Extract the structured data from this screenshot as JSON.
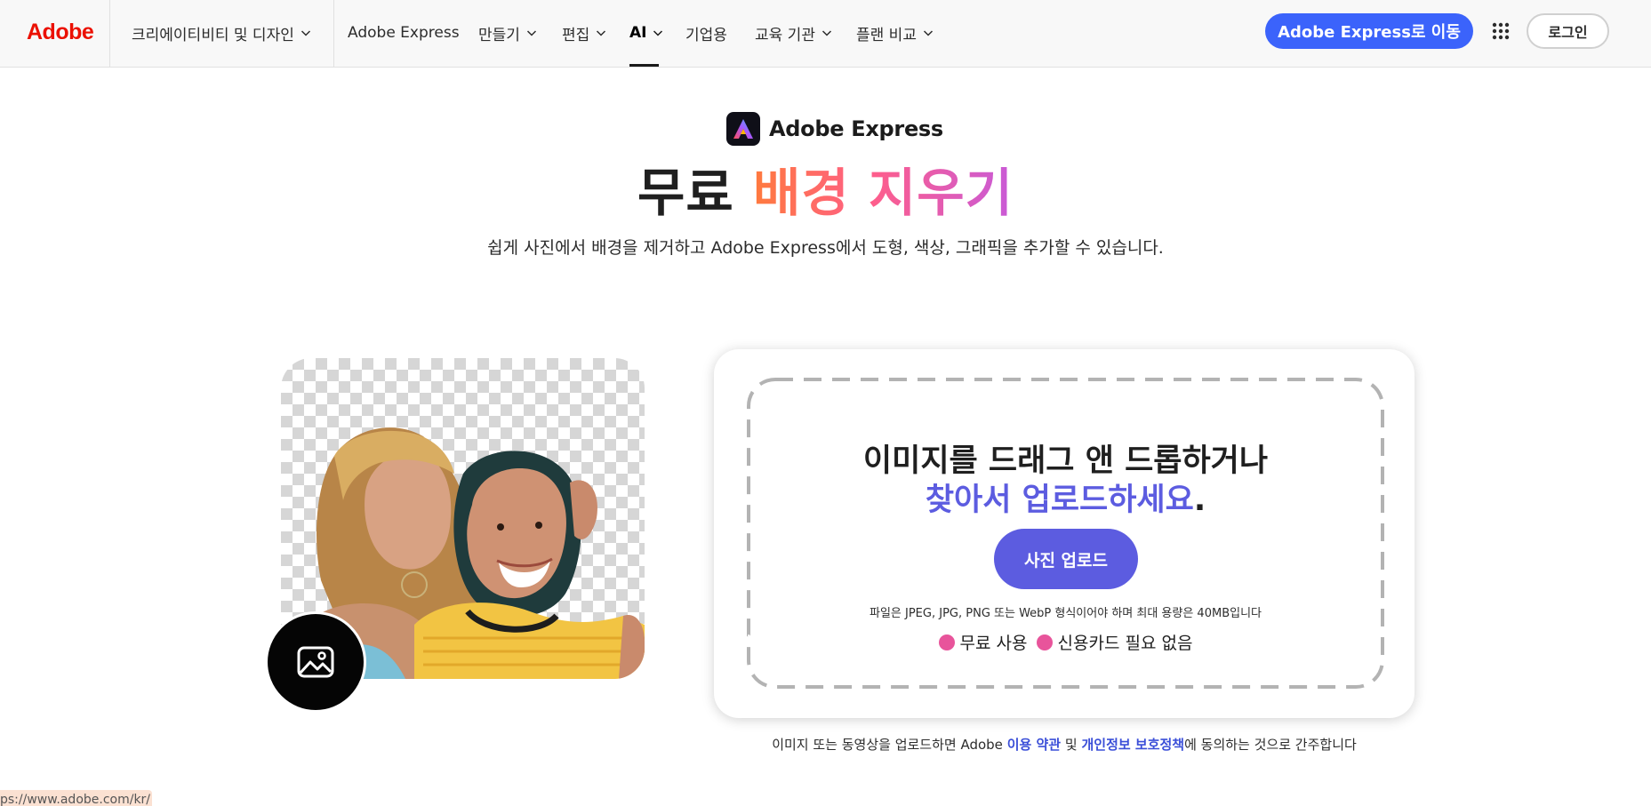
{
  "nav": {
    "logo": "Adobe",
    "items": [
      {
        "label": "크리에이티비티 및 디자인",
        "dropdown": true
      },
      {
        "label": "Adobe Express",
        "dropdown": false
      },
      {
        "label": "만들기",
        "dropdown": true
      },
      {
        "label": "편집",
        "dropdown": true
      },
      {
        "label": "AI",
        "dropdown": true,
        "active": true
      },
      {
        "label": "기업용",
        "dropdown": false
      },
      {
        "label": "교육 기관",
        "dropdown": true
      },
      {
        "label": "플랜 비교",
        "dropdown": true
      }
    ],
    "cta_label": "Adobe Express로 이동",
    "apps_icon": "grid-apps-icon",
    "login_label": "로그인"
  },
  "hero": {
    "brand_name": "Adobe Express",
    "title_plain": "무료 ",
    "title_highlight": "배경 지우기",
    "subtitle": "쉽게 사진에서 배경을 제거하고 Adobe Express에서 도형, 색상, 그래픽을 추가할 수 있습니다."
  },
  "upload": {
    "title_line1": "이미지를 드래그 앤 드롭하거나",
    "title_line2_highlight": "찾아서 업로드하세요",
    "title_line2_end": ".",
    "button_label": "사진 업로드",
    "file_note": "파일은 JPEG, JPG, PNG 또는 WebP 형식이어야 하며 최대 용량은 40MB입니다",
    "perks": [
      "무료 사용",
      "신용카드 필요 없음"
    ]
  },
  "terms": {
    "prefix": "이미지 또는 동영상을 업로드하면 Adobe ",
    "link1": "이용 약관",
    "middle": " 및 ",
    "link2": "개인정보 보호정책",
    "suffix": "에 동의하는 것으로 간주합니다"
  },
  "status_url": "ps://www.adobe.com/kr/",
  "colors": {
    "adobe_red": "#eb1000",
    "cta_blue": "#3b63fb",
    "upload_purple": "#5c5ce0",
    "check_pink": "#e8549b"
  }
}
